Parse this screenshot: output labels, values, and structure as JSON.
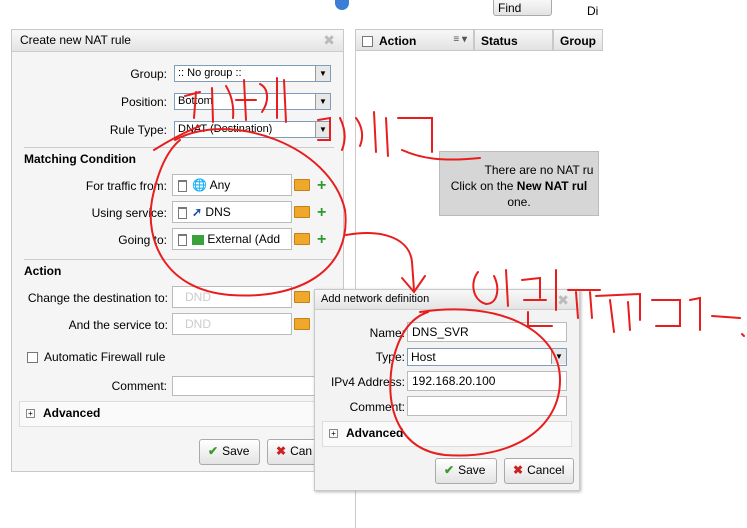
{
  "top": {
    "find_label": "Find",
    "cut_label": "Di"
  },
  "panel": {
    "title": "Create new NAT rule",
    "group_label": "Group:",
    "group_value": ":: No group ::",
    "position_label": "Position:",
    "position_value": "Bottom",
    "ruletype_label": "Rule Type:",
    "ruletype_value": "DNAT (Destination)",
    "matching_title": "Matching Condition",
    "traffic_label": "For traffic from:",
    "traffic_value": "Any",
    "service_label": "Using service:",
    "service_value": "DNS",
    "going_label": "Going to:",
    "going_value": "External (Add",
    "action_title": "Action",
    "dest_label": "Change the destination to:",
    "dest_placeholder": "DND",
    "service_to_label": "And the service to:",
    "service_to_placeholder": "DND",
    "auto_fw_label": "Automatic Firewall rule",
    "comment_label": "Comment:",
    "advanced_label": "Advanced",
    "save_label": "Save",
    "cancel_label": "Can"
  },
  "grid": {
    "col_action": "Action",
    "col_status": "Status",
    "col_group": "Group",
    "notice_line1": "There are no NAT ru",
    "notice_line2_pre": "Click on the ",
    "notice_line2_bold": "New NAT rul",
    "notice_line3": "one."
  },
  "dialog": {
    "title": "Add network definition",
    "name_label": "Name:",
    "name_value": "DNS_SVR",
    "type_label": "Type:",
    "type_value": "Host",
    "ipv4_label": "IPv4 Address:",
    "ipv4_value": "192.168.20.100",
    "comment_label": "Comment:",
    "advanced_label": "Advanced",
    "save_label": "Save",
    "cancel_label": "Cancel"
  },
  "colors": {
    "annotation_red": "#e81e1e",
    "accept_green": "#3a9a2a",
    "cancel_red": "#cc2222",
    "folder_orange": "#f0a82b"
  }
}
